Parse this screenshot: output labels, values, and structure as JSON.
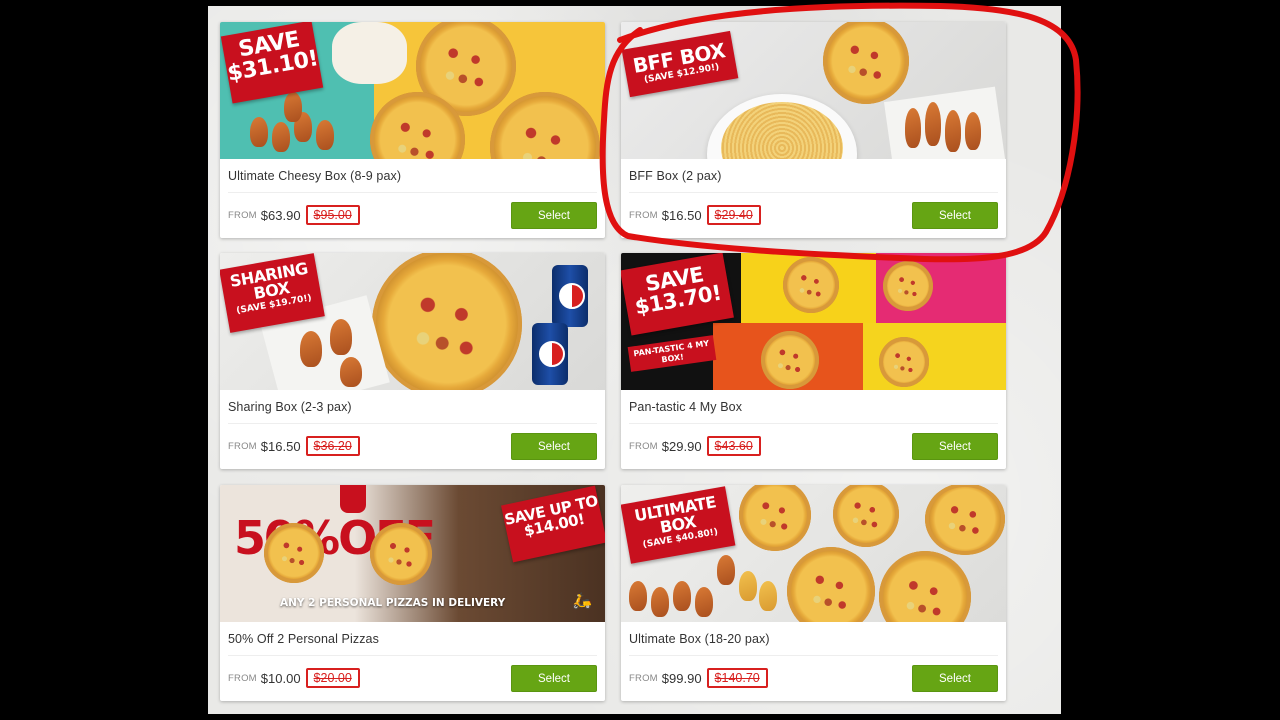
{
  "from_label": "FROM",
  "button_label": "Select",
  "colors": {
    "select": "#66a514",
    "strike": "#d8201f",
    "annotation": "#e01010",
    "tag": "#c8101e"
  },
  "products": [
    {
      "title": "Ultimate Cheesy Box (8-9 pax)",
      "price": "$63.90",
      "original_price": "$95.00",
      "banner_big": "SAVE\n$31.10!",
      "banner_small": ""
    },
    {
      "title": "BFF Box (2 pax)",
      "price": "$16.50",
      "original_price": "$29.40",
      "banner_big": "BFF BOX",
      "banner_small": "(SAVE $12.90!)"
    },
    {
      "title": "Sharing Box (2-3 pax)",
      "price": "$16.50",
      "original_price": "$36.20",
      "banner_big": "SHARING BOX",
      "banner_small": "(SAVE $19.70!)"
    },
    {
      "title": "Pan-tastic 4 My Box",
      "price": "$29.90",
      "original_price": "$43.60",
      "banner_big": "SAVE\n$13.70!",
      "banner_small": "PAN-TASTIC 4 MY BOX!"
    },
    {
      "title": "50% Off 2 Personal Pizzas",
      "price": "$10.00",
      "original_price": "$20.00",
      "banner_big": "SAVE UP TO $14.00!",
      "banner_small": "ANY 2 PERSONAL PIZZAS IN DELIVERY",
      "promo_text": "50%OFF"
    },
    {
      "title": "Ultimate Box (18-20 pax)",
      "price": "$99.90",
      "original_price": "$140.70",
      "banner_big": "ULTIMATE BOX",
      "banner_small": "(SAVE $40.80!)"
    }
  ],
  "icons": [
    "delivery-scooter-icon"
  ]
}
